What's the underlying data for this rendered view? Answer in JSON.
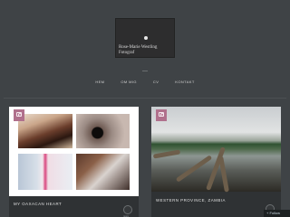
{
  "site": {
    "title": "Rose-Marie Westling\nFotograf"
  },
  "nav": {
    "items": [
      "HEM",
      "OM MIG",
      "CV",
      "KONTAKT"
    ]
  },
  "posts": [
    {
      "caption": "MY OAXACAN HEART",
      "more_label": "more"
    },
    {
      "caption": "WESTERN PROVINCE, ZAMBIA"
    }
  ],
  "follow": {
    "label": "+ Follow"
  },
  "colors": {
    "background": "#3f4346",
    "badge": "#b0708c",
    "card_dark": "#2f3234"
  }
}
